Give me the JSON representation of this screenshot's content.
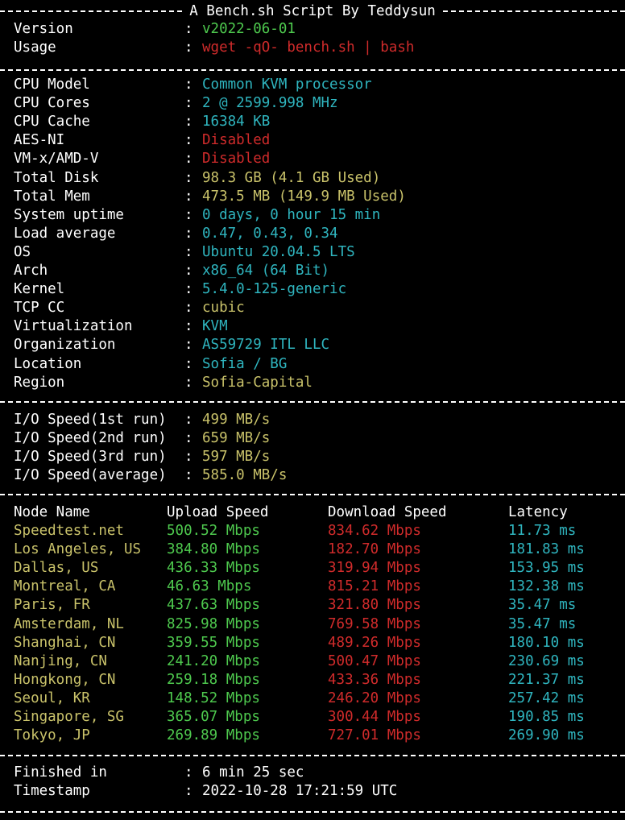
{
  "title": "A Bench.sh Script By Teddysun",
  "colors": {
    "green": "#4ec94e",
    "red": "#d02b2b",
    "cyan": "#2fb5bf",
    "yellow": "#c9c26a",
    "white": "#ffffff"
  },
  "header": [
    {
      "key": "Version",
      "value": "v2022-06-01",
      "color": "green"
    },
    {
      "key": "Usage",
      "value": "wget -qO- bench.sh | bash",
      "color": "red"
    }
  ],
  "system": [
    {
      "key": "CPU Model",
      "value": "Common KVM processor",
      "color": "cyan"
    },
    {
      "key": "CPU Cores",
      "value": "2 @ 2599.998 MHz",
      "color": "cyan"
    },
    {
      "key": "CPU Cache",
      "value": "16384 KB",
      "color": "cyan"
    },
    {
      "key": "AES-NI",
      "value": "Disabled",
      "color": "red"
    },
    {
      "key": "VM-x/AMD-V",
      "value": "Disabled",
      "color": "red"
    },
    {
      "key": "Total Disk",
      "value": "98.3 GB (4.1 GB Used)",
      "color": "yellow"
    },
    {
      "key": "Total Mem",
      "value": "473.5 MB (149.9 MB Used)",
      "color": "yellow"
    },
    {
      "key": "System uptime",
      "value": "0 days, 0 hour 15 min",
      "color": "cyan"
    },
    {
      "key": "Load average",
      "value": "0.47, 0.43, 0.34",
      "color": "cyan"
    },
    {
      "key": "OS",
      "value": "Ubuntu 20.04.5 LTS",
      "color": "cyan"
    },
    {
      "key": "Arch",
      "value": "x86_64 (64 Bit)",
      "color": "cyan"
    },
    {
      "key": "Kernel",
      "value": "5.4.0-125-generic",
      "color": "cyan"
    },
    {
      "key": "TCP CC",
      "value": "cubic",
      "color": "yellow"
    },
    {
      "key": "Virtualization",
      "value": "KVM",
      "color": "cyan"
    },
    {
      "key": "Organization",
      "value": "AS59729 ITL LLC",
      "color": "cyan"
    },
    {
      "key": "Location",
      "value": "Sofia / BG",
      "color": "cyan"
    },
    {
      "key": "Region",
      "value": "Sofia-Capital",
      "color": "yellow"
    }
  ],
  "io": [
    {
      "key": "I/O Speed(1st run)",
      "value": "499 MB/s",
      "color": "yellow"
    },
    {
      "key": "I/O Speed(2nd run)",
      "value": "659 MB/s",
      "color": "yellow"
    },
    {
      "key": "I/O Speed(3rd run)",
      "value": "597 MB/s",
      "color": "yellow"
    },
    {
      "key": "I/O Speed(average)",
      "value": "585.0 MB/s",
      "color": "yellow"
    }
  ],
  "speed": {
    "headers": [
      "Node Name",
      "Upload Speed",
      "Download Speed",
      "Latency"
    ],
    "rows": [
      [
        "Speedtest.net",
        "500.52 Mbps",
        "834.62 Mbps",
        "11.73 ms"
      ],
      [
        "Los Angeles, US",
        "384.80 Mbps",
        "182.70 Mbps",
        "181.83 ms"
      ],
      [
        "Dallas, US",
        "436.33 Mbps",
        "319.94 Mbps",
        "153.95 ms"
      ],
      [
        "Montreal, CA",
        "46.63 Mbps",
        "815.21 Mbps",
        "132.38 ms"
      ],
      [
        "Paris, FR",
        "437.63 Mbps",
        "321.80 Mbps",
        "35.47 ms"
      ],
      [
        "Amsterdam, NL",
        "825.98 Mbps",
        "769.58 Mbps",
        "35.47 ms"
      ],
      [
        "Shanghai, CN",
        "359.55 Mbps",
        "489.26 Mbps",
        "180.10 ms"
      ],
      [
        "Nanjing, CN",
        "241.20 Mbps",
        "500.47 Mbps",
        "230.69 ms"
      ],
      [
        "Hongkong, CN",
        "259.18 Mbps",
        "433.36 Mbps",
        "221.37 ms"
      ],
      [
        "Seoul, KR",
        "148.52 Mbps",
        "246.20 Mbps",
        "257.42 ms"
      ],
      [
        "Singapore, SG",
        "365.07 Mbps",
        "300.44 Mbps",
        "190.85 ms"
      ],
      [
        "Tokyo, JP",
        "269.89 Mbps",
        "727.01 Mbps",
        "269.90 ms"
      ]
    ]
  },
  "footer": [
    {
      "key": "Finished in",
      "value": "6 min 25 sec",
      "color": "white"
    },
    {
      "key": "Timestamp",
      "value": "2022-10-28 17:21:59 UTC",
      "color": "white"
    }
  ]
}
